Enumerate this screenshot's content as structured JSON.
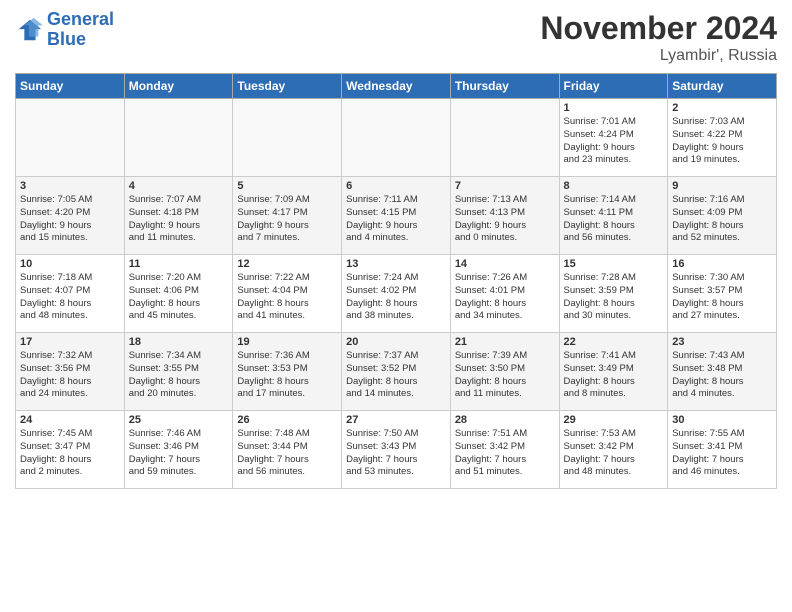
{
  "header": {
    "logo_line1": "General",
    "logo_line2": "Blue",
    "month_title": "November 2024",
    "location": "Lyambir', Russia"
  },
  "weekdays": [
    "Sunday",
    "Monday",
    "Tuesday",
    "Wednesday",
    "Thursday",
    "Friday",
    "Saturday"
  ],
  "weeks": [
    [
      {
        "day": "",
        "info": ""
      },
      {
        "day": "",
        "info": ""
      },
      {
        "day": "",
        "info": ""
      },
      {
        "day": "",
        "info": ""
      },
      {
        "day": "",
        "info": ""
      },
      {
        "day": "1",
        "info": "Sunrise: 7:01 AM\nSunset: 4:24 PM\nDaylight: 9 hours\nand 23 minutes."
      },
      {
        "day": "2",
        "info": "Sunrise: 7:03 AM\nSunset: 4:22 PM\nDaylight: 9 hours\nand 19 minutes."
      }
    ],
    [
      {
        "day": "3",
        "info": "Sunrise: 7:05 AM\nSunset: 4:20 PM\nDaylight: 9 hours\nand 15 minutes."
      },
      {
        "day": "4",
        "info": "Sunrise: 7:07 AM\nSunset: 4:18 PM\nDaylight: 9 hours\nand 11 minutes."
      },
      {
        "day": "5",
        "info": "Sunrise: 7:09 AM\nSunset: 4:17 PM\nDaylight: 9 hours\nand 7 minutes."
      },
      {
        "day": "6",
        "info": "Sunrise: 7:11 AM\nSunset: 4:15 PM\nDaylight: 9 hours\nand 4 minutes."
      },
      {
        "day": "7",
        "info": "Sunrise: 7:13 AM\nSunset: 4:13 PM\nDaylight: 9 hours\nand 0 minutes."
      },
      {
        "day": "8",
        "info": "Sunrise: 7:14 AM\nSunset: 4:11 PM\nDaylight: 8 hours\nand 56 minutes."
      },
      {
        "day": "9",
        "info": "Sunrise: 7:16 AM\nSunset: 4:09 PM\nDaylight: 8 hours\nand 52 minutes."
      }
    ],
    [
      {
        "day": "10",
        "info": "Sunrise: 7:18 AM\nSunset: 4:07 PM\nDaylight: 8 hours\nand 48 minutes."
      },
      {
        "day": "11",
        "info": "Sunrise: 7:20 AM\nSunset: 4:06 PM\nDaylight: 8 hours\nand 45 minutes."
      },
      {
        "day": "12",
        "info": "Sunrise: 7:22 AM\nSunset: 4:04 PM\nDaylight: 8 hours\nand 41 minutes."
      },
      {
        "day": "13",
        "info": "Sunrise: 7:24 AM\nSunset: 4:02 PM\nDaylight: 8 hours\nand 38 minutes."
      },
      {
        "day": "14",
        "info": "Sunrise: 7:26 AM\nSunset: 4:01 PM\nDaylight: 8 hours\nand 34 minutes."
      },
      {
        "day": "15",
        "info": "Sunrise: 7:28 AM\nSunset: 3:59 PM\nDaylight: 8 hours\nand 30 minutes."
      },
      {
        "day": "16",
        "info": "Sunrise: 7:30 AM\nSunset: 3:57 PM\nDaylight: 8 hours\nand 27 minutes."
      }
    ],
    [
      {
        "day": "17",
        "info": "Sunrise: 7:32 AM\nSunset: 3:56 PM\nDaylight: 8 hours\nand 24 minutes."
      },
      {
        "day": "18",
        "info": "Sunrise: 7:34 AM\nSunset: 3:55 PM\nDaylight: 8 hours\nand 20 minutes."
      },
      {
        "day": "19",
        "info": "Sunrise: 7:36 AM\nSunset: 3:53 PM\nDaylight: 8 hours\nand 17 minutes."
      },
      {
        "day": "20",
        "info": "Sunrise: 7:37 AM\nSunset: 3:52 PM\nDaylight: 8 hours\nand 14 minutes."
      },
      {
        "day": "21",
        "info": "Sunrise: 7:39 AM\nSunset: 3:50 PM\nDaylight: 8 hours\nand 11 minutes."
      },
      {
        "day": "22",
        "info": "Sunrise: 7:41 AM\nSunset: 3:49 PM\nDaylight: 8 hours\nand 8 minutes."
      },
      {
        "day": "23",
        "info": "Sunrise: 7:43 AM\nSunset: 3:48 PM\nDaylight: 8 hours\nand 4 minutes."
      }
    ],
    [
      {
        "day": "24",
        "info": "Sunrise: 7:45 AM\nSunset: 3:47 PM\nDaylight: 8 hours\nand 2 minutes."
      },
      {
        "day": "25",
        "info": "Sunrise: 7:46 AM\nSunset: 3:46 PM\nDaylight: 7 hours\nand 59 minutes."
      },
      {
        "day": "26",
        "info": "Sunrise: 7:48 AM\nSunset: 3:44 PM\nDaylight: 7 hours\nand 56 minutes."
      },
      {
        "day": "27",
        "info": "Sunrise: 7:50 AM\nSunset: 3:43 PM\nDaylight: 7 hours\nand 53 minutes."
      },
      {
        "day": "28",
        "info": "Sunrise: 7:51 AM\nSunset: 3:42 PM\nDaylight: 7 hours\nand 51 minutes."
      },
      {
        "day": "29",
        "info": "Sunrise: 7:53 AM\nSunset: 3:42 PM\nDaylight: 7 hours\nand 48 minutes."
      },
      {
        "day": "30",
        "info": "Sunrise: 7:55 AM\nSunset: 3:41 PM\nDaylight: 7 hours\nand 46 minutes."
      }
    ]
  ]
}
